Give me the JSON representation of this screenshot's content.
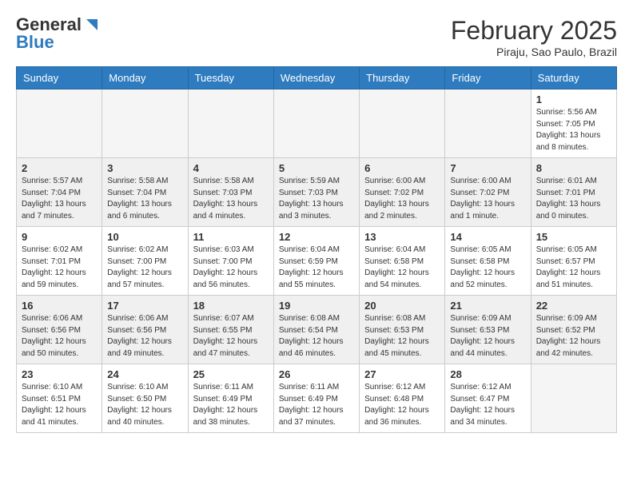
{
  "header": {
    "logo_general": "General",
    "logo_blue": "Blue",
    "month_title": "February 2025",
    "location": "Piraju, Sao Paulo, Brazil"
  },
  "weekdays": [
    "Sunday",
    "Monday",
    "Tuesday",
    "Wednesday",
    "Thursday",
    "Friday",
    "Saturday"
  ],
  "weeks": [
    [
      {
        "day": "",
        "info": "",
        "empty": true
      },
      {
        "day": "",
        "info": "",
        "empty": true
      },
      {
        "day": "",
        "info": "",
        "empty": true
      },
      {
        "day": "",
        "info": "",
        "empty": true
      },
      {
        "day": "",
        "info": "",
        "empty": true
      },
      {
        "day": "",
        "info": "",
        "empty": true
      },
      {
        "day": "1",
        "info": "Sunrise: 5:56 AM\nSunset: 7:05 PM\nDaylight: 13 hours and 8 minutes."
      }
    ],
    [
      {
        "day": "2",
        "info": "Sunrise: 5:57 AM\nSunset: 7:04 PM\nDaylight: 13 hours and 7 minutes."
      },
      {
        "day": "3",
        "info": "Sunrise: 5:58 AM\nSunset: 7:04 PM\nDaylight: 13 hours and 6 minutes."
      },
      {
        "day": "4",
        "info": "Sunrise: 5:58 AM\nSunset: 7:03 PM\nDaylight: 13 hours and 4 minutes."
      },
      {
        "day": "5",
        "info": "Sunrise: 5:59 AM\nSunset: 7:03 PM\nDaylight: 13 hours and 3 minutes."
      },
      {
        "day": "6",
        "info": "Sunrise: 6:00 AM\nSunset: 7:02 PM\nDaylight: 13 hours and 2 minutes."
      },
      {
        "day": "7",
        "info": "Sunrise: 6:00 AM\nSunset: 7:02 PM\nDaylight: 13 hours and 1 minute."
      },
      {
        "day": "8",
        "info": "Sunrise: 6:01 AM\nSunset: 7:01 PM\nDaylight: 13 hours and 0 minutes."
      }
    ],
    [
      {
        "day": "9",
        "info": "Sunrise: 6:02 AM\nSunset: 7:01 PM\nDaylight: 12 hours and 59 minutes."
      },
      {
        "day": "10",
        "info": "Sunrise: 6:02 AM\nSunset: 7:00 PM\nDaylight: 12 hours and 57 minutes."
      },
      {
        "day": "11",
        "info": "Sunrise: 6:03 AM\nSunset: 7:00 PM\nDaylight: 12 hours and 56 minutes."
      },
      {
        "day": "12",
        "info": "Sunrise: 6:04 AM\nSunset: 6:59 PM\nDaylight: 12 hours and 55 minutes."
      },
      {
        "day": "13",
        "info": "Sunrise: 6:04 AM\nSunset: 6:58 PM\nDaylight: 12 hours and 54 minutes."
      },
      {
        "day": "14",
        "info": "Sunrise: 6:05 AM\nSunset: 6:58 PM\nDaylight: 12 hours and 52 minutes."
      },
      {
        "day": "15",
        "info": "Sunrise: 6:05 AM\nSunset: 6:57 PM\nDaylight: 12 hours and 51 minutes."
      }
    ],
    [
      {
        "day": "16",
        "info": "Sunrise: 6:06 AM\nSunset: 6:56 PM\nDaylight: 12 hours and 50 minutes."
      },
      {
        "day": "17",
        "info": "Sunrise: 6:06 AM\nSunset: 6:56 PM\nDaylight: 12 hours and 49 minutes."
      },
      {
        "day": "18",
        "info": "Sunrise: 6:07 AM\nSunset: 6:55 PM\nDaylight: 12 hours and 47 minutes."
      },
      {
        "day": "19",
        "info": "Sunrise: 6:08 AM\nSunset: 6:54 PM\nDaylight: 12 hours and 46 minutes."
      },
      {
        "day": "20",
        "info": "Sunrise: 6:08 AM\nSunset: 6:53 PM\nDaylight: 12 hours and 45 minutes."
      },
      {
        "day": "21",
        "info": "Sunrise: 6:09 AM\nSunset: 6:53 PM\nDaylight: 12 hours and 44 minutes."
      },
      {
        "day": "22",
        "info": "Sunrise: 6:09 AM\nSunset: 6:52 PM\nDaylight: 12 hours and 42 minutes."
      }
    ],
    [
      {
        "day": "23",
        "info": "Sunrise: 6:10 AM\nSunset: 6:51 PM\nDaylight: 12 hours and 41 minutes."
      },
      {
        "day": "24",
        "info": "Sunrise: 6:10 AM\nSunset: 6:50 PM\nDaylight: 12 hours and 40 minutes."
      },
      {
        "day": "25",
        "info": "Sunrise: 6:11 AM\nSunset: 6:49 PM\nDaylight: 12 hours and 38 minutes."
      },
      {
        "day": "26",
        "info": "Sunrise: 6:11 AM\nSunset: 6:49 PM\nDaylight: 12 hours and 37 minutes."
      },
      {
        "day": "27",
        "info": "Sunrise: 6:12 AM\nSunset: 6:48 PM\nDaylight: 12 hours and 36 minutes."
      },
      {
        "day": "28",
        "info": "Sunrise: 6:12 AM\nSunset: 6:47 PM\nDaylight: 12 hours and 34 minutes."
      },
      {
        "day": "",
        "info": "",
        "empty": true
      }
    ]
  ]
}
